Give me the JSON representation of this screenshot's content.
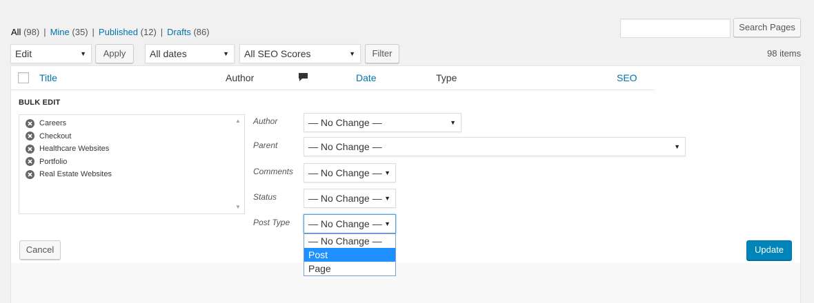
{
  "views": {
    "all_label": "All",
    "all_count": "(98)",
    "mine_label": "Mine",
    "mine_count": "(35)",
    "published_label": "Published",
    "published_count": "(12)",
    "drafts_label": "Drafts",
    "drafts_count": "(86)",
    "separator": "|"
  },
  "search": {
    "placeholder": "",
    "button_label": "Search Pages"
  },
  "toolbar": {
    "bulk_action": "Edit",
    "apply_label": "Apply",
    "date_filter": "All dates",
    "seo_filter": "All SEO Scores",
    "filter_label": "Filter",
    "items_count": "98 items"
  },
  "table": {
    "columns": {
      "title": "Title",
      "author": "Author",
      "date": "Date",
      "type": "Type",
      "seo": "SEO"
    },
    "comments_icon": "comment-bubble-icon"
  },
  "bulk_edit": {
    "heading": "BULK EDIT",
    "titles": [
      "Careers",
      "Checkout",
      "Healthcare Websites",
      "Portfolio",
      "Real Estate Websites"
    ],
    "remove_icon": "remove-circle-icon",
    "fields": {
      "author_label": "Author",
      "author_value": "— No Change —",
      "parent_label": "Parent",
      "parent_value": "— No Change —",
      "comments_label": "Comments",
      "comments_value": "— No Change —",
      "status_label": "Status",
      "status_value": "— No Change —",
      "post_type_label": "Post Type",
      "post_type_value": "— No Change —"
    },
    "post_type_options": [
      "— No Change —",
      "Post",
      "Page"
    ],
    "post_type_highlighted": "Post",
    "cancel_label": "Cancel",
    "update_label": "Update"
  },
  "colors": {
    "link": "#0073aa",
    "primary_button": "#0085ba",
    "highlight": "#1e90ff"
  }
}
